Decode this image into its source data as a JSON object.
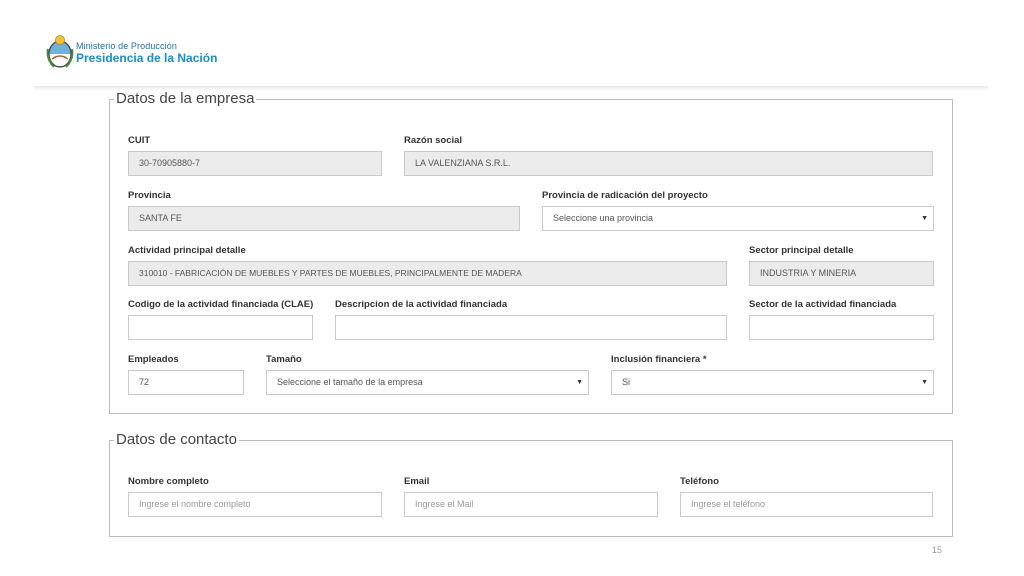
{
  "header": {
    "ministry": "Ministerio de Producción",
    "presidency": "Presidencia de la Nación",
    "colors": {
      "blue": "#1b8ec9",
      "dark_blue": "#1b6fa6"
    }
  },
  "empresa": {
    "legend": "Datos de la empresa",
    "cuit": {
      "label": "CUIT",
      "value": "30-70905880-7"
    },
    "razon_social": {
      "label": "Razón social",
      "value": "LA VALENZIANA S.R.L."
    },
    "provincia": {
      "label": "Provincia",
      "value": "SANTA FE"
    },
    "provincia_radicacion": {
      "label": "Provincia de radicación del proyecto",
      "value": "Seleccione una provincia"
    },
    "actividad_principal": {
      "label": "Actividad principal detalle",
      "value": "310010 - FABRICACIÓN DE MUEBLES Y PARTES DE MUEBLES, PRINCIPALMENTE DE MADERA"
    },
    "sector_principal": {
      "label": "Sector principal detalle",
      "value": "INDUSTRIA Y MINERIA"
    },
    "codigo_actividad": {
      "label": "Codigo de la actividad financiada (CLAE)",
      "value": ""
    },
    "descripcion_actividad": {
      "label": "Descripcion de la actividad financiada",
      "value": ""
    },
    "sector_actividad": {
      "label": "Sector de la actividad financiada",
      "value": ""
    },
    "empleados": {
      "label": "Empleados",
      "value": "72"
    },
    "tamano": {
      "label": "Tamaño",
      "value": "Seleccione el tamaño de la empresa"
    },
    "inclusion": {
      "label": "Inclusión financiera *",
      "value": "Si"
    }
  },
  "contacto": {
    "legend": "Datos de contacto",
    "nombre": {
      "label": "Nombre completo",
      "placeholder": "Ingrese el nombre completo"
    },
    "email": {
      "label": "Email",
      "placeholder": "Ingrese el Mail"
    },
    "telefono": {
      "label": "Teléfono",
      "placeholder": "Ingrese el teléfono"
    }
  },
  "page_number": "15",
  "icons": {
    "select_caret": "caret-down-icon",
    "logo": "argentina-coat-of-arms-icon"
  }
}
